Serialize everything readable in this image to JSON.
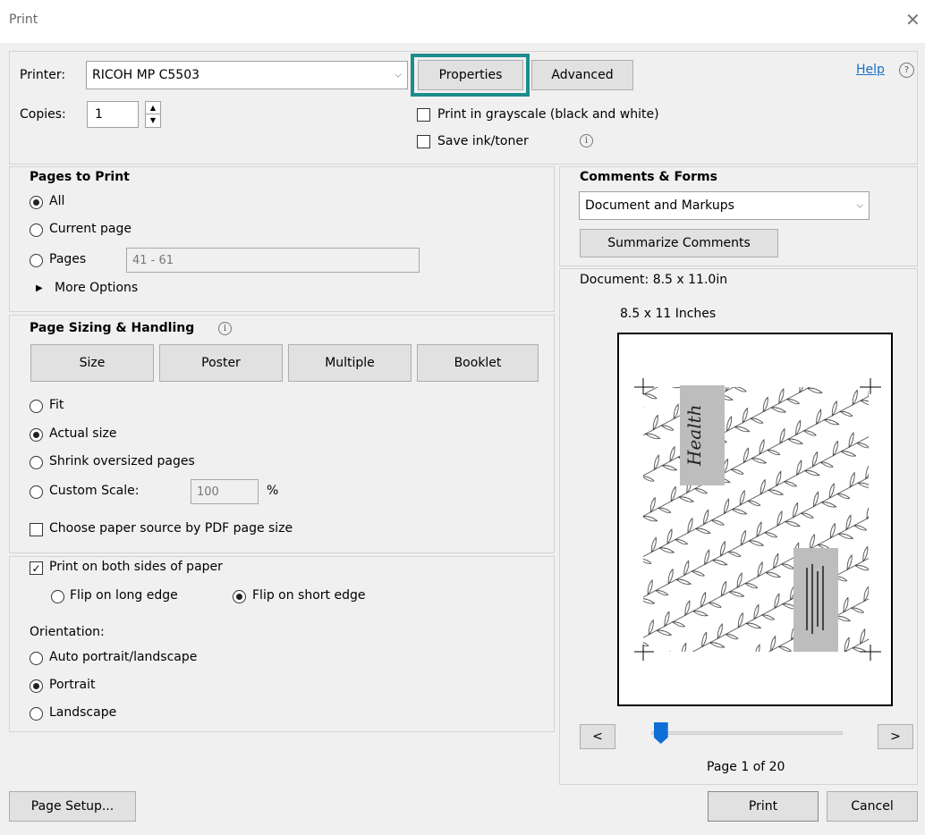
{
  "window": {
    "title": "Print",
    "close_glyph": "✕"
  },
  "top": {
    "printer_label": "Printer:",
    "printer_value": "RICOH MP C5503",
    "properties_label": "Properties",
    "advanced_label": "Advanced",
    "help_label": "Help",
    "help_icon": "?",
    "copies_label": "Copies:",
    "copies_value": "1",
    "grayscale_label": "Print in grayscale (black and white)",
    "grayscale_checked": false,
    "save_ink_label": "Save ink/toner",
    "save_ink_checked": false,
    "highlight_color": "#1e8c8c"
  },
  "pages_to_print": {
    "heading": "Pages to Print",
    "all_label": "All",
    "current_label": "Current page",
    "pages_label": "Pages",
    "pages_value": "41 - 61",
    "more_options_label": "More Options",
    "selected": "All"
  },
  "sizing": {
    "heading": "Page Sizing & Handling",
    "buttons": [
      "Size",
      "Poster",
      "Multiple",
      "Booklet"
    ],
    "fit_label": "Fit",
    "actual_label": "Actual size",
    "shrink_label": "Shrink oversized pages",
    "custom_label": "Custom Scale:",
    "custom_value": "100",
    "percent": "%",
    "paper_source_label": "Choose paper source by PDF page size",
    "selected": "Actual size"
  },
  "duplex": {
    "both_sides_label": "Print on both sides of paper",
    "both_sides_checked": true,
    "long_edge_label": "Flip on long edge",
    "short_edge_label": "Flip on short edge",
    "selected": "Flip on short edge",
    "orientation_label": "Orientation:",
    "auto_label": "Auto portrait/landscape",
    "portrait_label": "Portrait",
    "landscape_label": "Landscape",
    "orientation_selected": "Portrait"
  },
  "comments": {
    "heading": "Comments & Forms",
    "value": "Document and Markups",
    "summarize_label": "Summarize Comments"
  },
  "preview": {
    "document_label": "Document: 8.5 x 11.0in",
    "size_label": "8.5 x 11 Inches",
    "prev_label": "<",
    "next_label": ">",
    "page_label": "Page 1 of 20",
    "slider_position": 0.05,
    "health_text": "Health"
  },
  "footer": {
    "page_setup_label": "Page Setup...",
    "print_label": "Print",
    "cancel_label": "Cancel"
  }
}
